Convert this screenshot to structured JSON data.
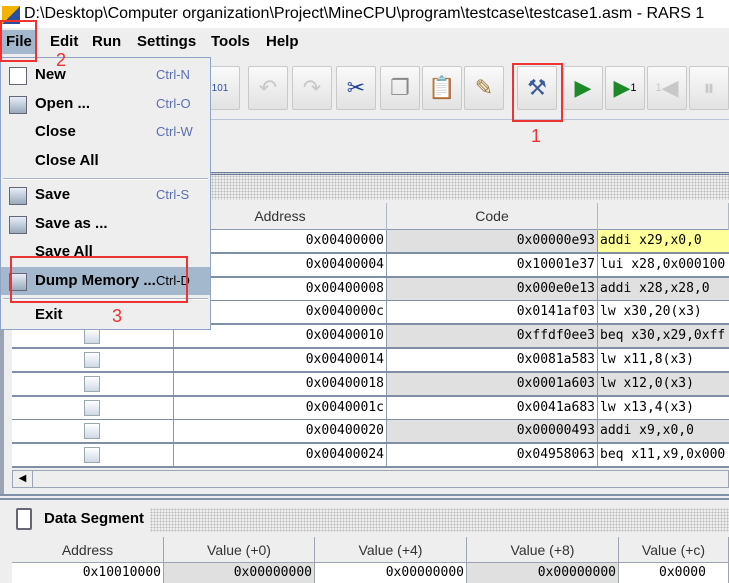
{
  "window": {
    "title": "D:\\Desktop\\Computer organization\\Project\\MineCPU\\program\\testcase\\testcase1.asm  - RARS 1"
  },
  "menubar": [
    "File",
    "Edit",
    "Run",
    "Settings",
    "Tools",
    "Help"
  ],
  "file_menu": [
    {
      "label": "New",
      "shortcut": "Ctrl-N",
      "icon": "new-file-icon"
    },
    {
      "label": "Open ...",
      "shortcut": "Ctrl-O",
      "icon": "open-folder-icon"
    },
    {
      "label": "Close",
      "shortcut": "Ctrl-W"
    },
    {
      "label": "Close All",
      "shortcut": ""
    },
    {
      "label": "Save",
      "shortcut": "Ctrl-S",
      "icon": "save-icon"
    },
    {
      "label": "Save as ...",
      "shortcut": "",
      "icon": "save-as-icon"
    },
    {
      "label": "Save All",
      "shortcut": ""
    },
    {
      "label": "Dump Memory ...",
      "shortcut": "Ctrl-D",
      "icon": "dump-memory-icon",
      "selected": true
    },
    {
      "label": "Exit",
      "shortcut": ""
    }
  ],
  "toolbar": {
    "dump_icon_text": "101",
    "step_label": "1",
    "backstep_label": "1"
  },
  "annotations": [
    "1",
    "2",
    "3"
  ],
  "text_segment": {
    "headers": [
      "Address",
      "Code"
    ],
    "rows": [
      {
        "address": "0x00400000",
        "code": "0x00000e93",
        "basic": "addi x29,x0,0"
      },
      {
        "address": "0x00400004",
        "code": "0x10001e37",
        "basic": "lui x28,0x000100"
      },
      {
        "address": "0x00400008",
        "code": "0x000e0e13",
        "basic": "addi x28,x28,0"
      },
      {
        "address": "0x0040000c",
        "code": "0x0141af03",
        "basic": "lw x30,20(x3)"
      },
      {
        "address": "0x00400010",
        "code": "0xffdf0ee3",
        "basic": "beq x30,x29,0xff"
      },
      {
        "address": "0x00400014",
        "code": "0x0081a583",
        "basic": "lw x11,8(x3)"
      },
      {
        "address": "0x00400018",
        "code": "0x0001a603",
        "basic": "lw x12,0(x3)"
      },
      {
        "address": "0x0040001c",
        "code": "0x0041a683",
        "basic": "lw x13,4(x3)"
      },
      {
        "address": "0x00400020",
        "code": "0x00000493",
        "basic": "addi x9,x0,0"
      },
      {
        "address": "0x00400024",
        "code": "0x04958063",
        "basic": "beq x11,x9,0x000"
      }
    ]
  },
  "data_segment": {
    "title": "Data Segment",
    "headers": [
      "Address",
      "Value (+0)",
      "Value (+4)",
      "Value (+8)",
      "Value (+c)"
    ],
    "row": [
      "0x10010000",
      "0x00000000",
      "0x00000000",
      "0x00000000",
      "0x0000"
    ]
  },
  "colors": {
    "highlight": "#ffff99",
    "selected_menu": "#a3b8cc",
    "annotation": "#ee3333"
  }
}
